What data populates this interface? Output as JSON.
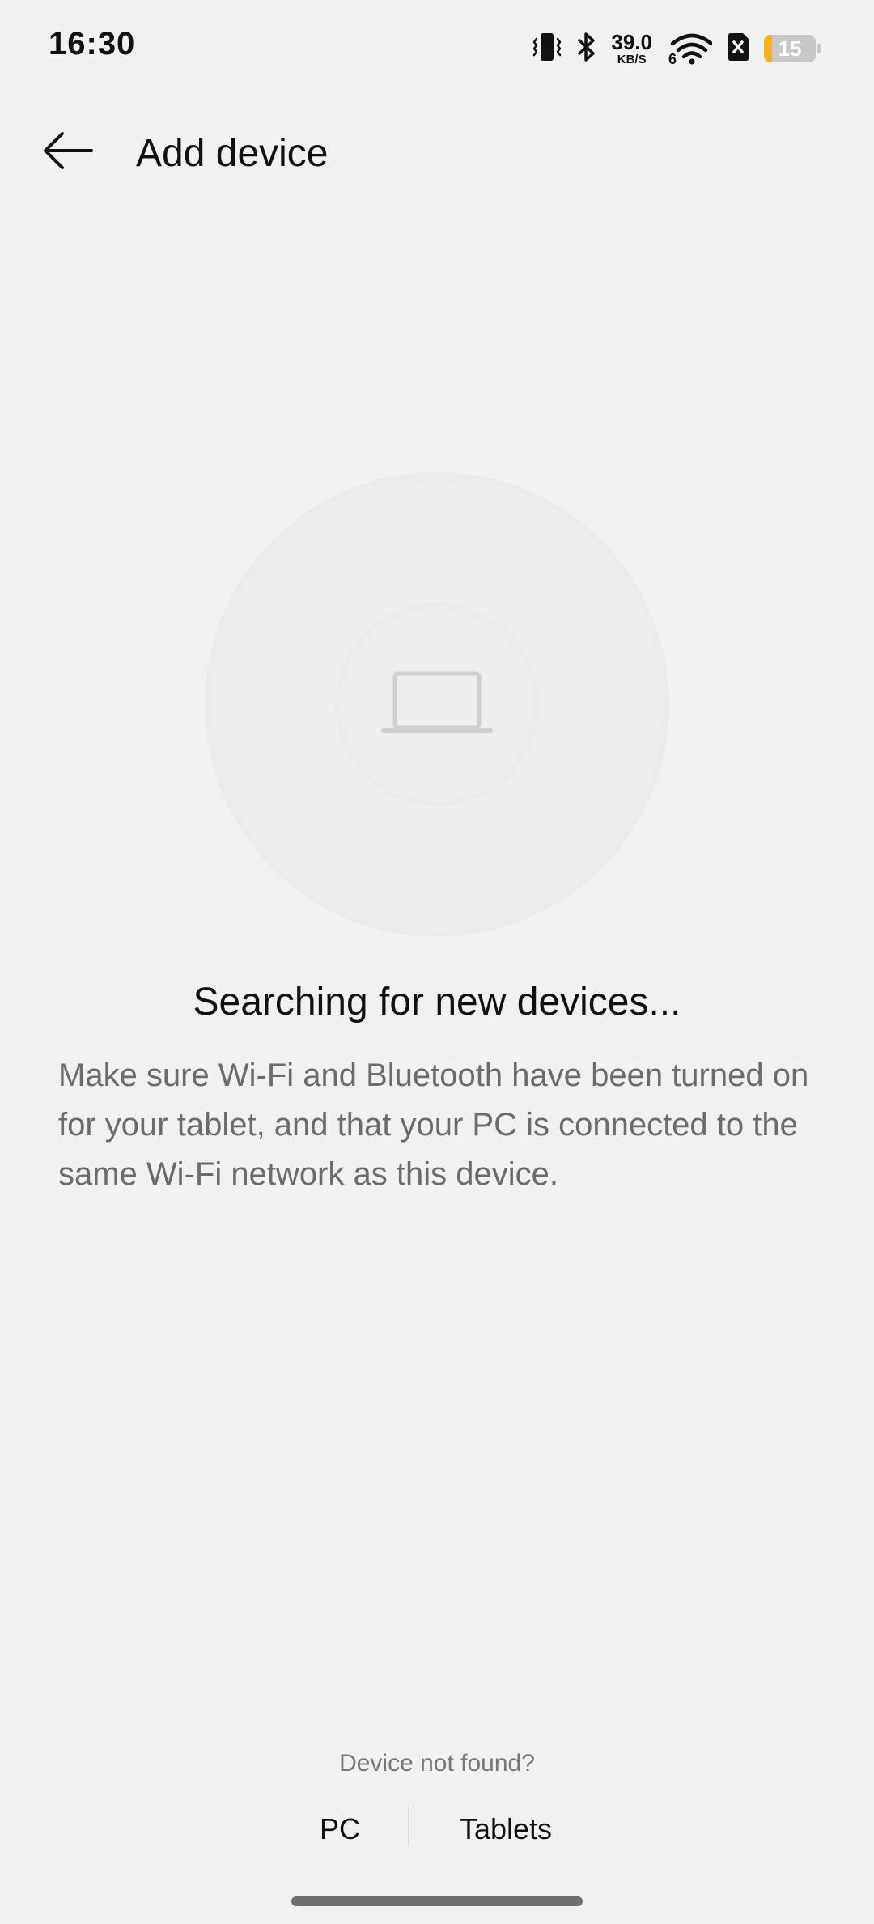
{
  "status_bar": {
    "time": "16:30",
    "net_speed": "39.0",
    "net_speed_unit": "KB/S",
    "wifi_generation": "6",
    "battery_level": "15",
    "battery_fraction": 0.15,
    "icons": [
      "vibrate-icon",
      "bluetooth-icon",
      "wifi-icon",
      "sim-card-icon",
      "battery-icon"
    ]
  },
  "header": {
    "title": "Add device"
  },
  "main": {
    "heading": "Searching for new devices...",
    "description": "Make sure Wi-Fi and Bluetooth have been turned on for your tablet, and that your PC is connected to the same Wi-Fi network as this device.",
    "illustration_icon": "laptop-icon"
  },
  "footer": {
    "not_found_label": "Device not found?",
    "links": [
      "PC",
      "Tablets"
    ]
  },
  "colors": {
    "background": "#f0f1f3",
    "battery_low": "#f0b323",
    "secondary_text": "#6b6b6b"
  }
}
